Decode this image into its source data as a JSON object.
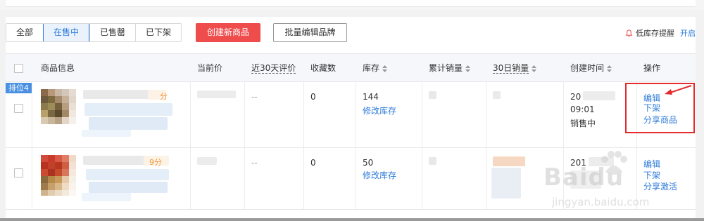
{
  "tabs": [
    {
      "label": "全部",
      "active": false
    },
    {
      "label": "在售中",
      "active": true
    },
    {
      "label": "已售罄",
      "active": false
    },
    {
      "label": "已下架",
      "active": false
    }
  ],
  "toolbar": {
    "create_label": "创建新商品",
    "batch_label": "批量编辑品牌",
    "lowstock_label": "低库存提醒",
    "lowstock_link": "开启"
  },
  "columns": {
    "product": "商品信息",
    "price": "当前价",
    "reviews": "近30天评价",
    "favorites": "收藏数",
    "stock": "库存",
    "total_sales": "累计销量",
    "sales30": "30日销量",
    "created": "创建时间",
    "actions": "操作"
  },
  "rows": [
    {
      "rank": "排位4",
      "score_suffix": "分",
      "reviews": "--",
      "favorites": "0",
      "stock": "144",
      "edit_stock": "修改库存",
      "created_prefix": "20",
      "created_time": "09:01",
      "status": "销售中",
      "actions": [
        "编辑",
        "下架",
        "分享商品"
      ]
    },
    {
      "score_suffix": "9分",
      "reviews": "--",
      "favorites": "0",
      "stock": "50",
      "edit_stock": "修改库存",
      "created_prefix": "201",
      "actions": [
        "编辑",
        "下架",
        "分享激活"
      ]
    }
  ],
  "watermark": {
    "brand": "Baidu",
    "url": "jingyan.baidu.com"
  },
  "colors": {
    "accent": "#2f7bd9",
    "danger": "#ef4c4c",
    "highlight": "#e52b2b"
  }
}
